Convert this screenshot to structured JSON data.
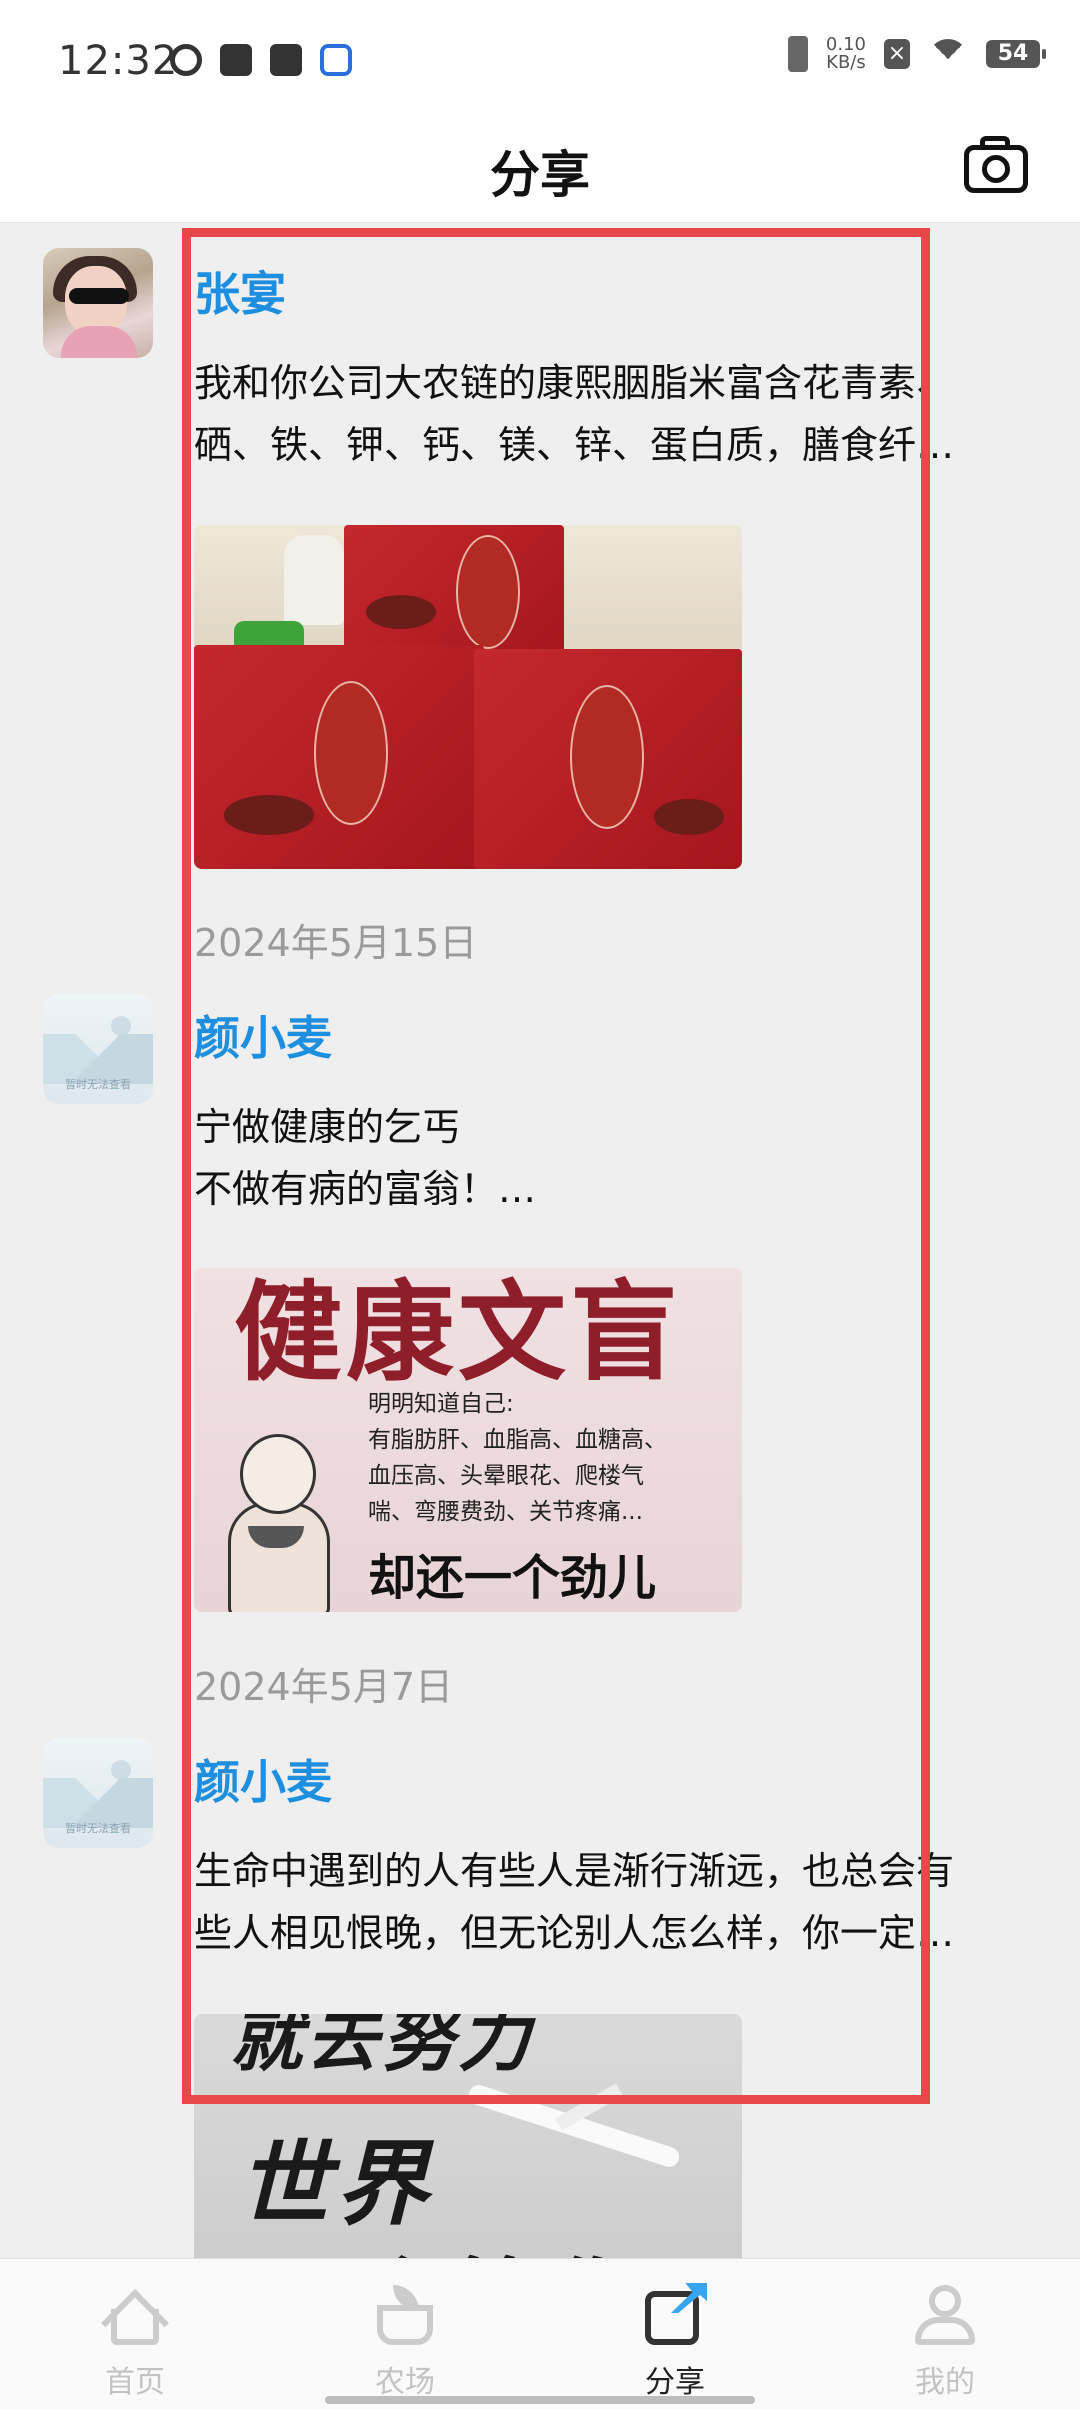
{
  "status_bar": {
    "time": "12:32",
    "net_speed_value": "0.10",
    "net_speed_unit": "KB/s",
    "battery": "54"
  },
  "header": {
    "title": "分享"
  },
  "posts": [
    {
      "username": "张宴",
      "content_lines": [
        "我和你公司大农链的康熙胭脂米富含花青素、",
        "硒、铁、钾、钙、镁、锌、蛋白质，膳食纤…"
      ],
      "date": "2024年5月15日"
    },
    {
      "username": "颜小麦",
      "avatar_caption": "暂时无法查看",
      "content_lines": [
        "宁做健康的乞丐",
        "不做有病的富翁！…"
      ],
      "image_text": {
        "headline": "健康文盲",
        "body": [
          "明明知道自己:",
          "有脂肪肝、血脂高、血糖高、",
          "血压高、头晕眼花、爬楼气",
          "喘、弯腰费劲、关节疼痛..."
        ],
        "footer": "却还一个劲儿"
      },
      "date": "2024年5月7日"
    },
    {
      "username": "颜小麦",
      "avatar_caption": "暂时无法查看",
      "content_lines": [
        "生命中遇到的人有些人是渐行渐远，也总会有",
        "些人相见恨晚，但无论别人怎么样，你一定…"
      ],
      "image_text": {
        "line1": "就去努力",
        "line2": "世界",
        "line3": "不会等你"
      }
    }
  ],
  "tabbar": {
    "tabs": [
      {
        "label": "首页",
        "icon": "home-icon"
      },
      {
        "label": "农场",
        "icon": "farm-icon"
      },
      {
        "label": "分享",
        "icon": "share-icon",
        "active": true
      },
      {
        "label": "我的",
        "icon": "profile-icon"
      }
    ]
  },
  "colors": {
    "username": "#1e8fe0",
    "highlight_box": "#e8484a",
    "active_tab_icon": "#37a5ef"
  }
}
